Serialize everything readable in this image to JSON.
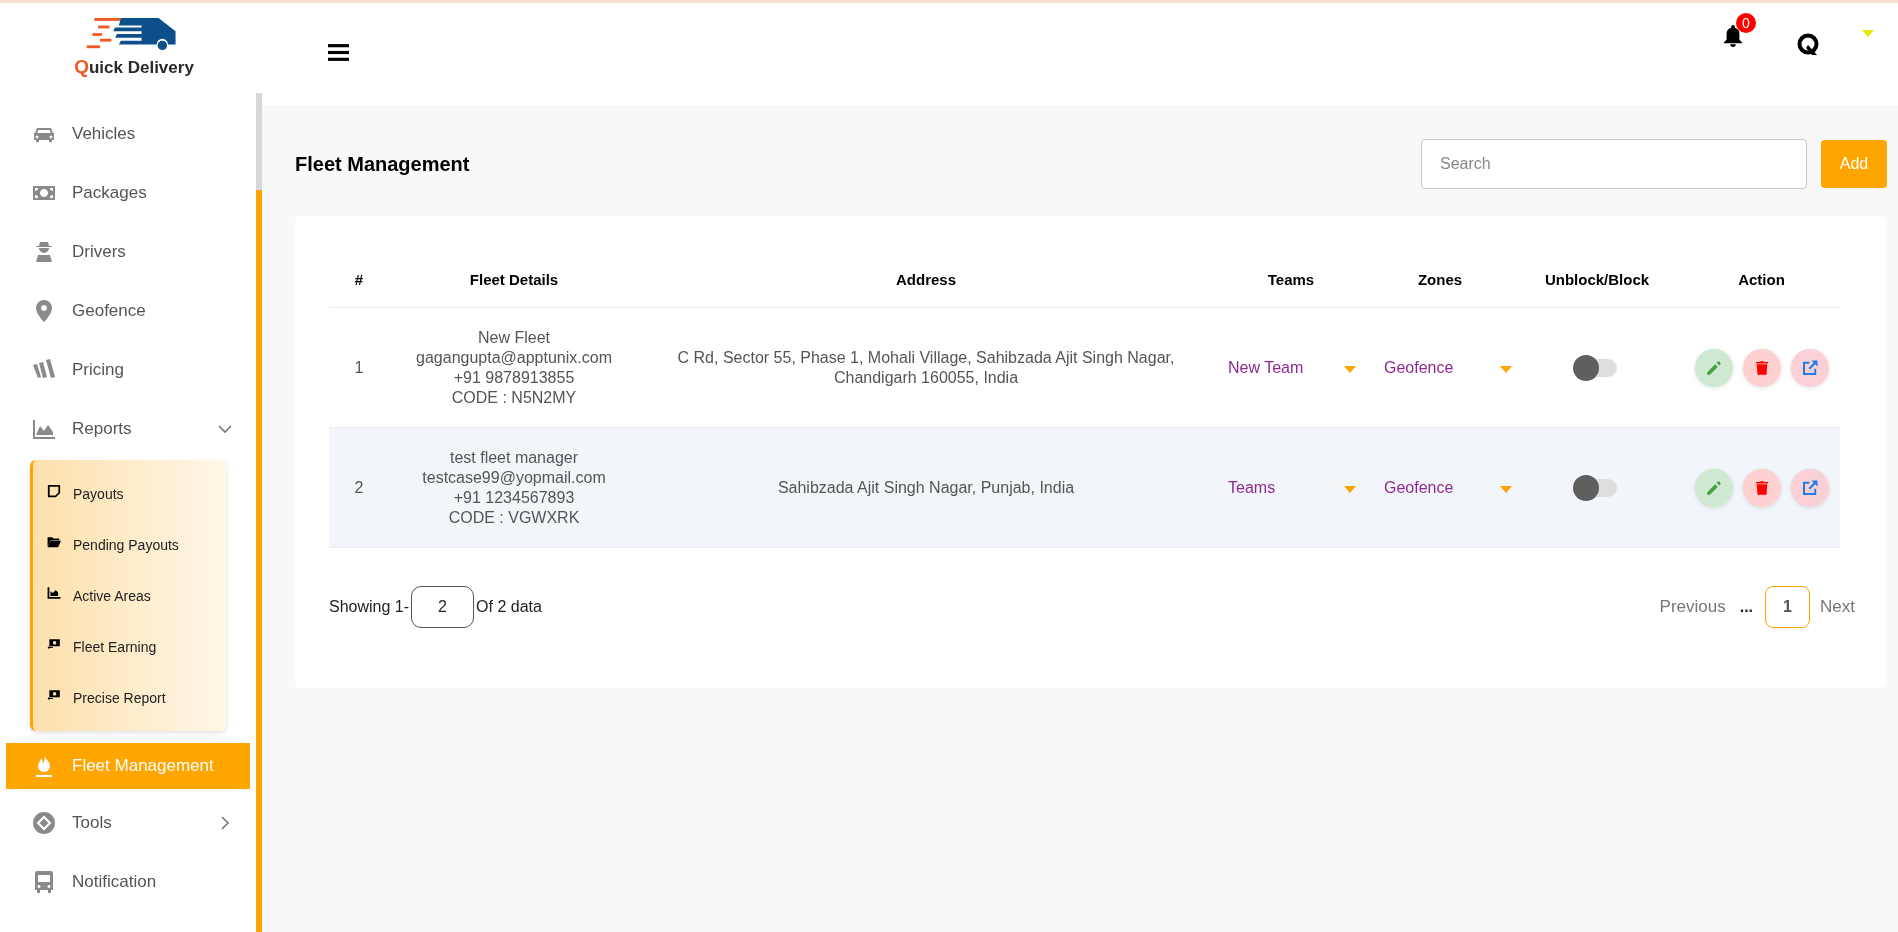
{
  "brand": {
    "name": "Quick Delivery"
  },
  "sidebar": {
    "items": [
      {
        "kind": "link",
        "label": "Vehicles",
        "selected": false
      },
      {
        "kind": "link",
        "label": "Packages",
        "selected": false
      },
      {
        "kind": "link",
        "label": "Drivers",
        "selected": false
      },
      {
        "kind": "link",
        "label": "Geofence",
        "selected": false
      },
      {
        "kind": "link",
        "label": "Pricing",
        "selected": false
      },
      {
        "kind": "group",
        "label": "Reports",
        "selected": false,
        "expanded": true,
        "children": [
          {
            "label": "Payouts",
            "selected": false
          },
          {
            "label": "Pending Payouts",
            "selected": false
          },
          {
            "label": "Active Areas",
            "selected": false
          },
          {
            "label": "Fleet Earning",
            "selected": false
          },
          {
            "label": "Precise Report",
            "selected": false
          }
        ]
      },
      {
        "kind": "link",
        "label": "Fleet Management",
        "selected": true
      },
      {
        "kind": "group",
        "label": "Tools",
        "selected": false,
        "expanded": false
      },
      {
        "kind": "link",
        "label": "Notification",
        "selected": false
      }
    ]
  },
  "header": {
    "notifications": {
      "count": "0"
    }
  },
  "page": {
    "title": "Fleet Management",
    "search": {
      "placeholder": "Search"
    },
    "add_button": "Add"
  },
  "table": {
    "columns": [
      "#",
      "Fleet Details",
      "Address",
      "Teams",
      "Zones",
      "Unblock/Block",
      "Action"
    ],
    "rows": [
      {
        "number": "1",
        "name": "New Fleet",
        "email": "gagangupta@apptunix.com",
        "phone": "+91 9878913855",
        "code": "CODE : N5N2MY",
        "address": "C Rd, Sector 55, Phase 1, Mohali Village, Sahibzada Ajit Singh Nagar, Chandigarh 160055, India",
        "team": "New Team",
        "zone": "Geofence",
        "on": false,
        "selected": false
      },
      {
        "number": "2",
        "name": "test fleet manager",
        "email": "testcase99@yopmail.com",
        "phone": "+91 1234567893",
        "code": "CODE : VGWXRK",
        "address": "Sahibzada Ajit Singh Nagar, Punjab, India",
        "team": "Teams",
        "zone": "Geofence",
        "on": false,
        "selected": true
      }
    ]
  },
  "pagination": {
    "showing_prefix": "Showing 1-",
    "page_size": "2",
    "showing_suffix": "Of 2 data",
    "previous": "Previous",
    "ellipsis": "...",
    "pages": [
      {
        "label": "1",
        "selected": true
      }
    ],
    "next": "Next"
  }
}
